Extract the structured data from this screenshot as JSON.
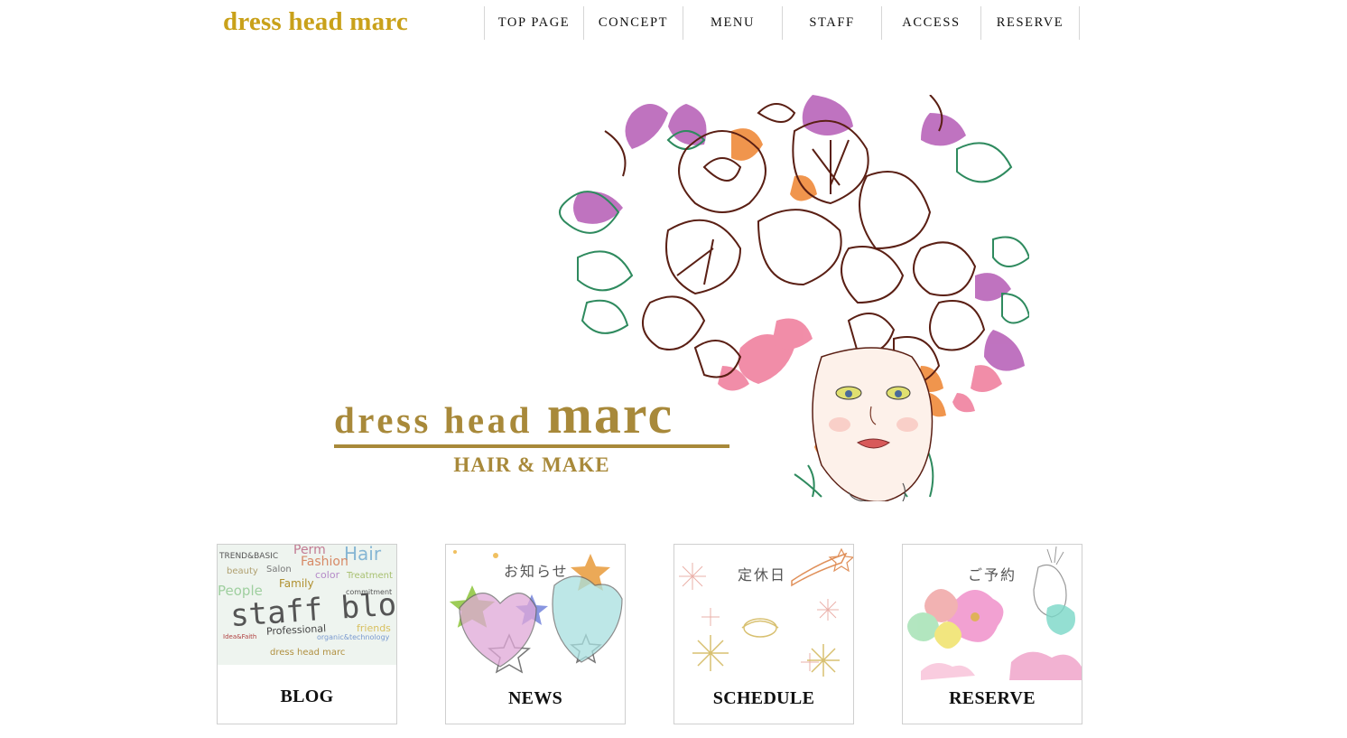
{
  "header": {
    "logo": "dress head marc",
    "nav": [
      {
        "label": "TOP PAGE"
      },
      {
        "label": "CONCEPT"
      },
      {
        "label": "MENU"
      },
      {
        "label": "STAFF"
      },
      {
        "label": "ACCESS"
      },
      {
        "label": "RESERVE"
      }
    ]
  },
  "hero": {
    "brand_small": "dress head",
    "brand_big": "marc",
    "brand_sub": "HAIR & MAKE"
  },
  "cards": [
    {
      "label": "BLOG",
      "image_words": [
        "TREND&BASIC",
        "Perm",
        "Hair",
        "beauty",
        "Salon",
        "Fashion",
        "color",
        "Treatment",
        "People",
        "Family",
        "commitment",
        "staff blog",
        "Professional",
        "friends",
        "Idea&Faith",
        "organic&technology",
        "dress head marc"
      ]
    },
    {
      "label": "NEWS",
      "image_title": "お知らせ"
    },
    {
      "label": "SCHEDULE",
      "image_title": "定休日"
    },
    {
      "label": "RESERVE",
      "image_title": "ご予約"
    }
  ],
  "colors": {
    "logo": "#c9a11a",
    "brand_gold": "#a8893a",
    "line_art": "#5a1f14",
    "leaf_green": "#2e8a5e",
    "petal_purple": "#b45bb5",
    "petal_orange": "#ef8a3a",
    "petal_pink": "#ef7a9a"
  }
}
